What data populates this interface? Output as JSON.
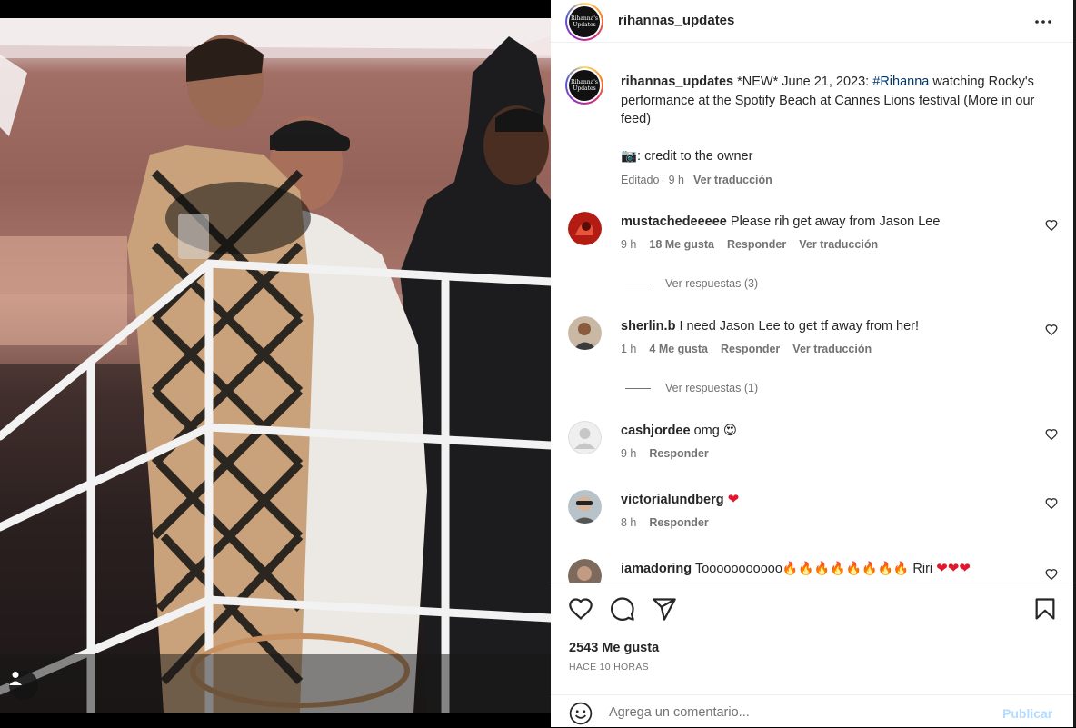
{
  "post": {
    "account": "rihannas_updates",
    "logo_text_line1": "Rihanna's",
    "logo_text_line2": "Updates",
    "caption": {
      "username": "rihannas_updates",
      "text_before": " *NEW* June 21, 2023: ",
      "hashtag": "#Rihanna",
      "text_after": " watching Rocky's performance at the Spotify Beach at Cannes Lions festival (More in our feed)",
      "credit": "📷: credit to the owner",
      "edited": "Editado",
      "age": "9 h",
      "translate": "Ver traducción"
    }
  },
  "comments": [
    {
      "username": "mustachedeeeee",
      "text": "Please rih get away from Jason Lee",
      "age": "9 h",
      "likes": "18 Me gusta",
      "reply": "Responder",
      "translate": "Ver traducción",
      "replies": "Ver respuestas (3)"
    },
    {
      "username": "sherlin.b",
      "text": "I need Jason Lee to get tf away from her!",
      "age": "1 h",
      "likes": "4 Me gusta",
      "reply": "Responder",
      "translate": "Ver traducción",
      "replies": "Ver respuestas (1)"
    },
    {
      "username": "cashjordee",
      "text": "omg",
      "emoji": "😍",
      "age": "9 h",
      "reply": "Responder"
    },
    {
      "username": "victorialundberg",
      "text": "",
      "emoji": "❤",
      "age": "8 h",
      "reply": "Responder"
    },
    {
      "username": "iamadoring",
      "text": "Tooooooooooo",
      "fire": "🔥🔥🔥🔥🔥🔥🔥🔥",
      "text2": "Riri",
      "hearts": "❤❤❤"
    }
  ],
  "actions": {
    "likes": "2543 Me gusta",
    "time": "HACE 10 HORAS",
    "comment_placeholder": "Agrega un comentario...",
    "publish": "Publicar"
  },
  "icons": [
    "more-icon",
    "heart-icon",
    "comment-icon",
    "share-icon",
    "bookmark-icon",
    "emoji-icon",
    "user-tag-icon"
  ],
  "colors": {
    "hashtag": "#00376b",
    "muted": "#737373",
    "publish_disabled": "#b3dbff",
    "heart_red": "#e3172b"
  }
}
